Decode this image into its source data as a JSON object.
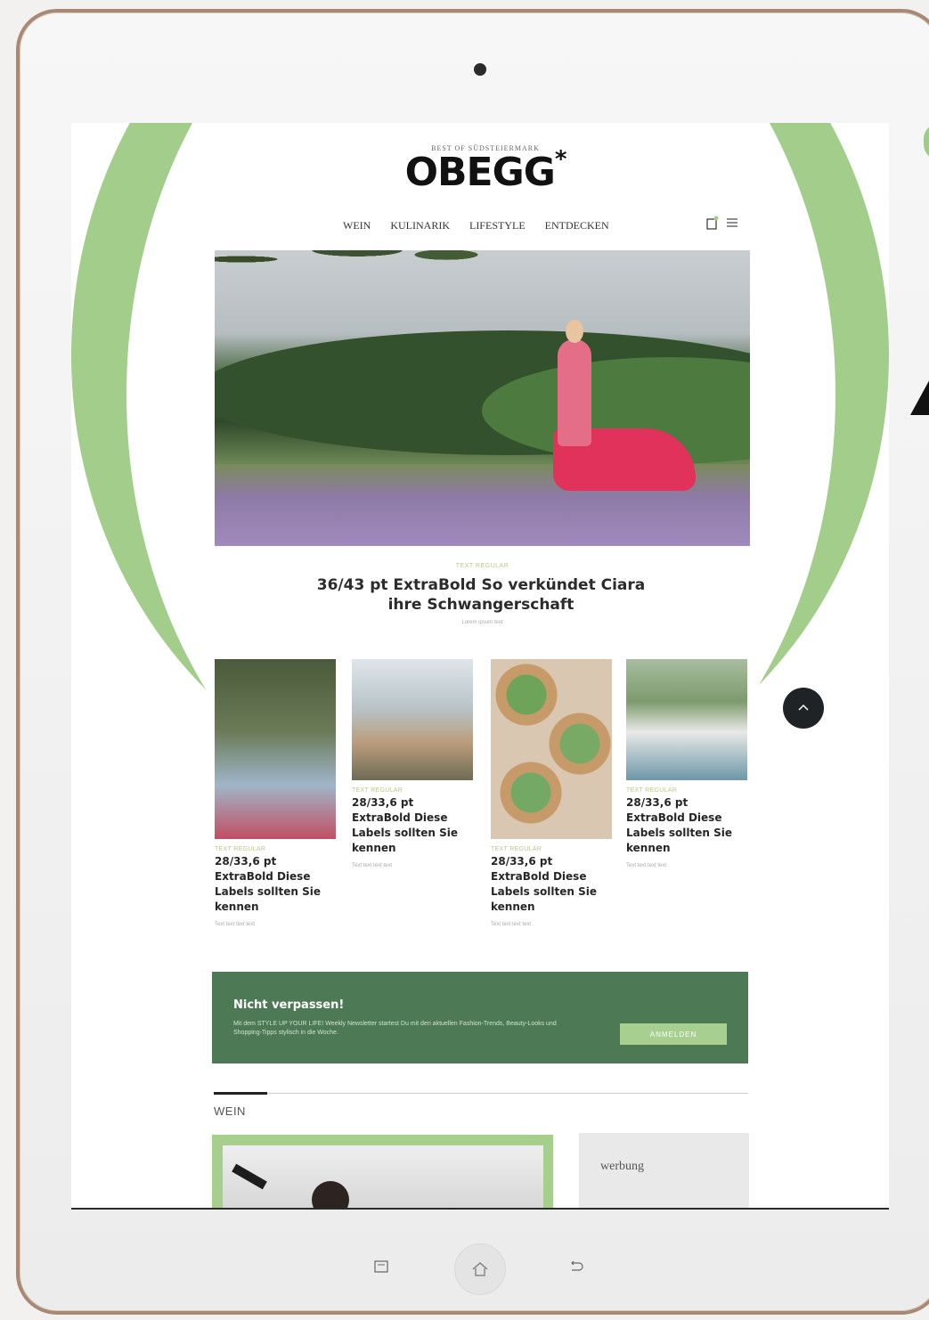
{
  "site": {
    "logo_sub": "BEST OF SÜDSTEIERMARK",
    "logo": "OBEGG",
    "logo_star": "*"
  },
  "nav": {
    "items": [
      "WEIN",
      "KULINARIK",
      "LIFESTYLE",
      "ENTDECKEN"
    ]
  },
  "hero": {
    "kicker": "TEXT REGULAR",
    "title_line1": "36/43 pt ExtraBold So verkündet Ciara",
    "title_line2": "ihre Schwangerschaft",
    "meta": "Lorem ipsum text"
  },
  "cards": [
    {
      "kicker": "TEXT REGULAR",
      "title": "28/33,6 pt ExtraBold Diese Labels sollten Sie kennen",
      "meta": "Text text text text"
    },
    {
      "kicker": "TEXT REGULAR",
      "title": "28/33,6 pt ExtraBold Diese Labels sollten Sie kennen",
      "meta": "Text text text text"
    },
    {
      "kicker": "TEXT REGULAR",
      "title": "28/33,6 pt ExtraBold Diese Labels sollten Sie kennen",
      "meta": "Text text text text"
    },
    {
      "kicker": "TEXT REGULAR",
      "title": "28/33,6 pt ExtraBold Diese Labels sollten Sie kennen",
      "meta": "Text text text text"
    }
  ],
  "newsletter": {
    "heading": "Nicht verpassen!",
    "text": "Mit dem STYLE UP YOUR LIFE! Weekly Newsletter startest Du mit den aktuellen Fashion-Trends, Beauty-Looks und Shopping-Tipps stylisch in die Woche.",
    "button": "ANMELDEN"
  },
  "section": {
    "label": "WEIN"
  },
  "ad": {
    "label": "werbung"
  },
  "colors": {
    "accent_green": "#a2cd8b",
    "newsletter_green": "#4d7a55",
    "button_green": "#a7cf8f",
    "frame_bronze": "#a78976"
  },
  "icons": {
    "cart": "cart-icon",
    "menu": "menu-icon",
    "scroll_top": "chevron-up-icon",
    "home": "home-icon",
    "back": "back-icon",
    "recent": "recent-apps-icon"
  }
}
